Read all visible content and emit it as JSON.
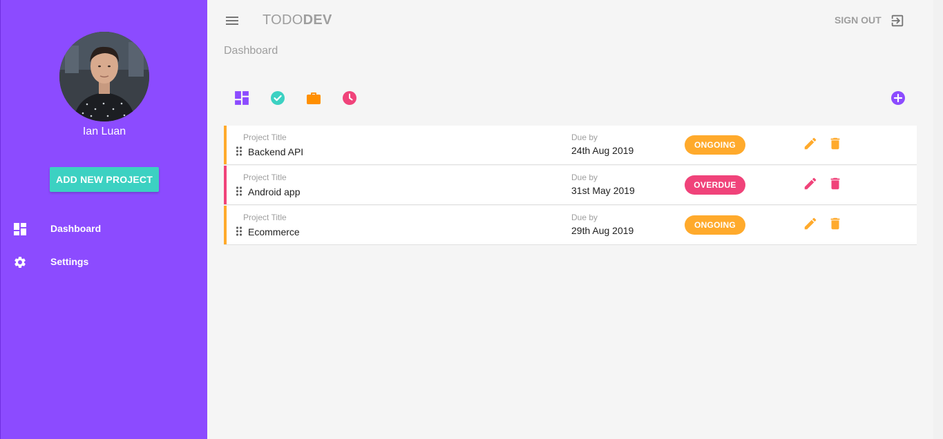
{
  "app": {
    "brand_light": "TODO",
    "brand_bold": "DEV",
    "sign_out_label": "SIGN OUT",
    "page_title": "Dashboard"
  },
  "sidebar": {
    "user_name": "Ian Luan",
    "add_project_label": "ADD NEW PROJECT",
    "nav": [
      {
        "label": "Dashboard",
        "icon": "dashboard-icon"
      },
      {
        "label": "Settings",
        "icon": "gear-icon"
      }
    ]
  },
  "filters": [
    {
      "name": "all-projects",
      "icon": "dashboard-icon",
      "color": "#8c4bff"
    },
    {
      "name": "completed",
      "icon": "check-circle-icon",
      "color": "#3cd1c2"
    },
    {
      "name": "ongoing",
      "icon": "briefcase-icon",
      "color": "#ff8f00"
    },
    {
      "name": "overdue",
      "icon": "clock-icon",
      "color": "#f0437a"
    }
  ],
  "projects": [
    {
      "caption": "Project Title",
      "title": "Backend API",
      "due_caption": "Due by",
      "due": "24th Aug 2019",
      "status": "ONGOING",
      "color": "#ffaa2c"
    },
    {
      "caption": "Project Title",
      "title": "Android app",
      "due_caption": "Due by",
      "due": "31st May 2019",
      "status": "OVERDUE",
      "color": "#f0437a"
    },
    {
      "caption": "Project Title",
      "title": "Ecommerce",
      "due_caption": "Due by",
      "due": "29th Aug 2019",
      "status": "ONGOING",
      "color": "#ffaa2c"
    }
  ],
  "colors": {
    "sidebar": "#8c4bff",
    "accent_teal": "#3cd1c2",
    "ongoing": "#ffaa2c",
    "overdue": "#f0437a",
    "muted_text": "#9e9e9e"
  }
}
